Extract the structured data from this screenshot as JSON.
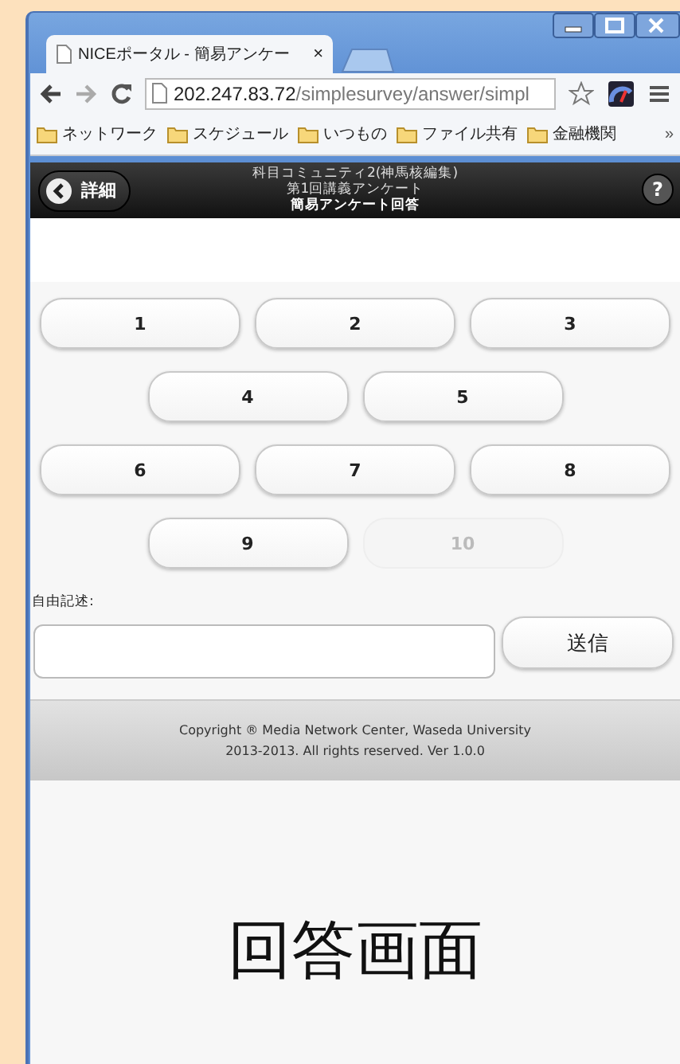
{
  "browser": {
    "tab": {
      "title": "NICEポータル - 簡易アンケー",
      "close": "×"
    },
    "address": {
      "host": "202.247.83.72",
      "path": "/simplesurvey/answer/simpl"
    },
    "bookmarks": [
      "ネットワーク",
      "スケジュール",
      "いつもの",
      "ファイル共有",
      "金融機関"
    ],
    "bookmarks_more": "»"
  },
  "header": {
    "back_label": "詳細",
    "titles": [
      "科目コミュニティ2(神馬核編集)",
      "第1回講義アンケート",
      "簡易アンケート回答"
    ],
    "help": "?"
  },
  "choice_rows": [
    [
      {
        "label": "1",
        "disabled": false
      },
      {
        "label": "2",
        "disabled": false
      },
      {
        "label": "3",
        "disabled": false
      }
    ],
    [
      {
        "label": "4",
        "disabled": false
      },
      {
        "label": "5",
        "disabled": false
      }
    ],
    [
      {
        "label": "6",
        "disabled": false
      },
      {
        "label": "7",
        "disabled": false
      },
      {
        "label": "8",
        "disabled": false
      }
    ],
    [
      {
        "label": "9",
        "disabled": false
      },
      {
        "label": "10",
        "disabled": true
      }
    ]
  ],
  "free_text": {
    "label": "自由記述:",
    "submit": "送信"
  },
  "footer": [
    "Copyright ® Media Network Center, Waseda University",
    "2013-2013. All rights reserved. Ver 1.0.0"
  ],
  "caption": "回答画面"
}
